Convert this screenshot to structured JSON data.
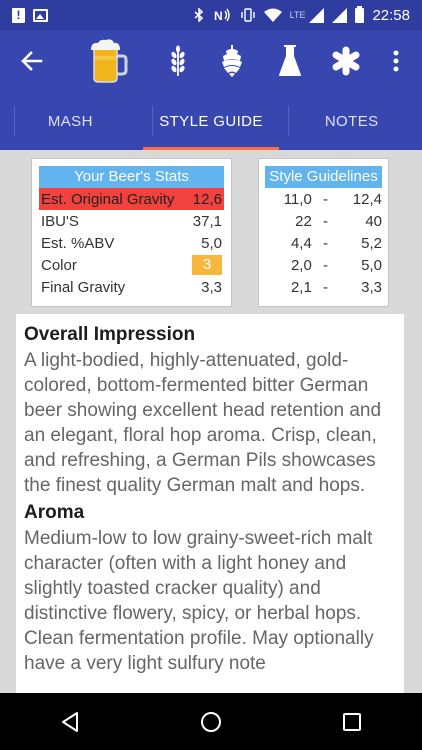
{
  "status_bar": {
    "time": "22:58",
    "network_type": "LTE",
    "icons": [
      "alert-icon",
      "image-icon",
      "bluetooth-icon",
      "nfc-icon",
      "vibrate-icon",
      "wifi-icon",
      "signal-icon",
      "battery-icon"
    ]
  },
  "app_bar": {
    "icons": [
      "back-arrow-icon",
      "beer-mug-icon",
      "wheat-icon",
      "hops-icon",
      "flask-icon",
      "asterisk-icon",
      "more-vert-icon"
    ],
    "accent_color": "#3847b0"
  },
  "tabs": [
    {
      "label": "MASH",
      "active": false
    },
    {
      "label": "STYLE GUIDE",
      "active": true
    },
    {
      "label": "NOTES",
      "active": false
    }
  ],
  "stats": {
    "title": "Your Beer's Stats",
    "rows": [
      {
        "label": "Est. Original Gravity",
        "value": "12,6"
      },
      {
        "label": "IBU'S",
        "value": "37,1"
      },
      {
        "label": "Est. %ABV",
        "value": "5,0"
      },
      {
        "label": "Color",
        "value": "3"
      },
      {
        "label": "Final Gravity",
        "value": "3,3"
      }
    ],
    "highlight_color": "#f2423d",
    "color_chip": "#f6b73c"
  },
  "guidelines": {
    "title": "Style Guidelines",
    "rows": [
      {
        "low": "11,0",
        "sep": "-",
        "high": "12,4"
      },
      {
        "low": "22",
        "sep": "-",
        "high": "40"
      },
      {
        "low": "4,4",
        "sep": "-",
        "high": "5,2"
      },
      {
        "low": "2,0",
        "sep": "-",
        "high": "5,0"
      },
      {
        "low": "2,1",
        "sep": "-",
        "high": "3,3"
      }
    ]
  },
  "description": {
    "sections": [
      {
        "heading": "Overall Impression",
        "body": "A light-bodied, highly-attenuated, gold-colored, bottom-fermented bitter German beer showing excellent head retention and an elegant, floral hop aroma. Crisp, clean, and refreshing, a German Pils showcases the finest quality German malt and hops."
      },
      {
        "heading": "Aroma",
        "body": "Medium-low to low grainy-sweet-rich malt character (often with a light honey and slightly toasted cracker quality) and distinctive flowery, spicy, or herbal hops. Clean fermentation profile. May optionally have a very light sulfury note"
      }
    ]
  },
  "nav_bar": {
    "icons": [
      "back-triangle-icon",
      "home-circle-icon",
      "recents-square-icon"
    ]
  }
}
